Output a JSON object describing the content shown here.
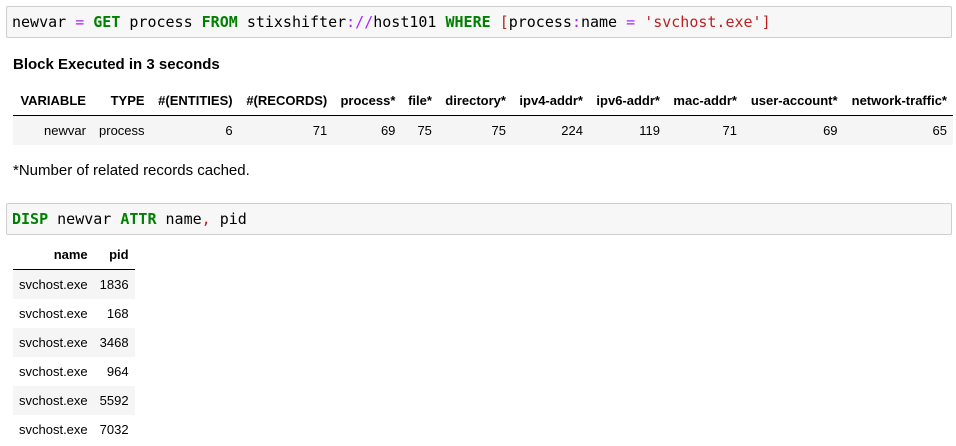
{
  "cell1": {
    "var": "newvar",
    "eq": "=",
    "kw_get": "GET",
    "entity": "process",
    "kw_from": "FROM",
    "source_a": "stixshifter",
    "source_sep": "://",
    "source_b": "host101",
    "kw_where": "WHERE",
    "lb": "[",
    "attr_a": "process",
    "colon": ":",
    "attr_b": "name",
    "eq2": "=",
    "value": "'svchost.exe'",
    "rb": "]"
  },
  "summary": {
    "title": "Block Executed in 3 seconds",
    "headers": [
      "VARIABLE",
      "TYPE",
      "#(ENTITIES)",
      "#(RECORDS)",
      "process*",
      "file*",
      "directory*",
      "ipv4-addr*",
      "ipv6-addr*",
      "mac-addr*",
      "user-account*",
      "network-traffic*"
    ],
    "row": [
      "newvar",
      "process",
      "6",
      "71",
      "69",
      "75",
      "75",
      "224",
      "119",
      "71",
      "69",
      "65"
    ],
    "note": "*Number of related records cached."
  },
  "cell2": {
    "kw_disp": "DISP",
    "var": "newvar",
    "kw_attr": "ATTR",
    "attr1": "name",
    "comma": ",",
    "attr2": "pid"
  },
  "result": {
    "headers": [
      "name",
      "pid"
    ],
    "rows": [
      [
        "svchost.exe",
        "1836"
      ],
      [
        "svchost.exe",
        "168"
      ],
      [
        "svchost.exe",
        "3468"
      ],
      [
        "svchost.exe",
        "964"
      ],
      [
        "svchost.exe",
        "5592"
      ],
      [
        "svchost.exe",
        "7032"
      ]
    ]
  }
}
